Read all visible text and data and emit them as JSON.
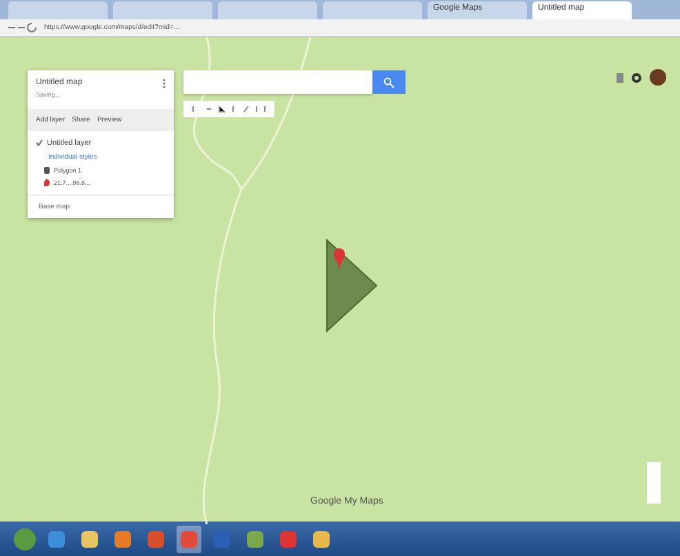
{
  "browser": {
    "tabs": [
      {
        "selected": false
      },
      {
        "selected": false
      },
      {
        "selected": false
      },
      {
        "selected": false
      },
      {
        "label": "Google Maps",
        "selected": false
      },
      {
        "label": "Untitled map",
        "selected": true
      }
    ],
    "url": "https://www.google.com/maps/d/edit?mid=..."
  },
  "panel": {
    "title": "Untitled map",
    "subtitle": "Saving...",
    "actions": [
      "Add layer",
      "Share",
      "Preview"
    ],
    "layer": {
      "name": "Untitled layer",
      "checked": true,
      "style_link": "Individual styles",
      "features": [
        {
          "kind": "polygon",
          "label": "Polygon 1"
        },
        {
          "kind": "marker",
          "label": "21.7...,86.8..."
        }
      ]
    },
    "base_map": "Base map"
  },
  "map": {
    "watermark": "Google My Maps"
  },
  "taskbar": {
    "apps": [
      {
        "kind": "ie"
      },
      {
        "kind": "folder"
      },
      {
        "kind": "media"
      },
      {
        "kind": "firefox"
      },
      {
        "kind": "chrome",
        "selected": true
      },
      {
        "kind": "word"
      },
      {
        "kind": "app"
      },
      {
        "kind": "opera"
      },
      {
        "kind": "files"
      }
    ]
  }
}
